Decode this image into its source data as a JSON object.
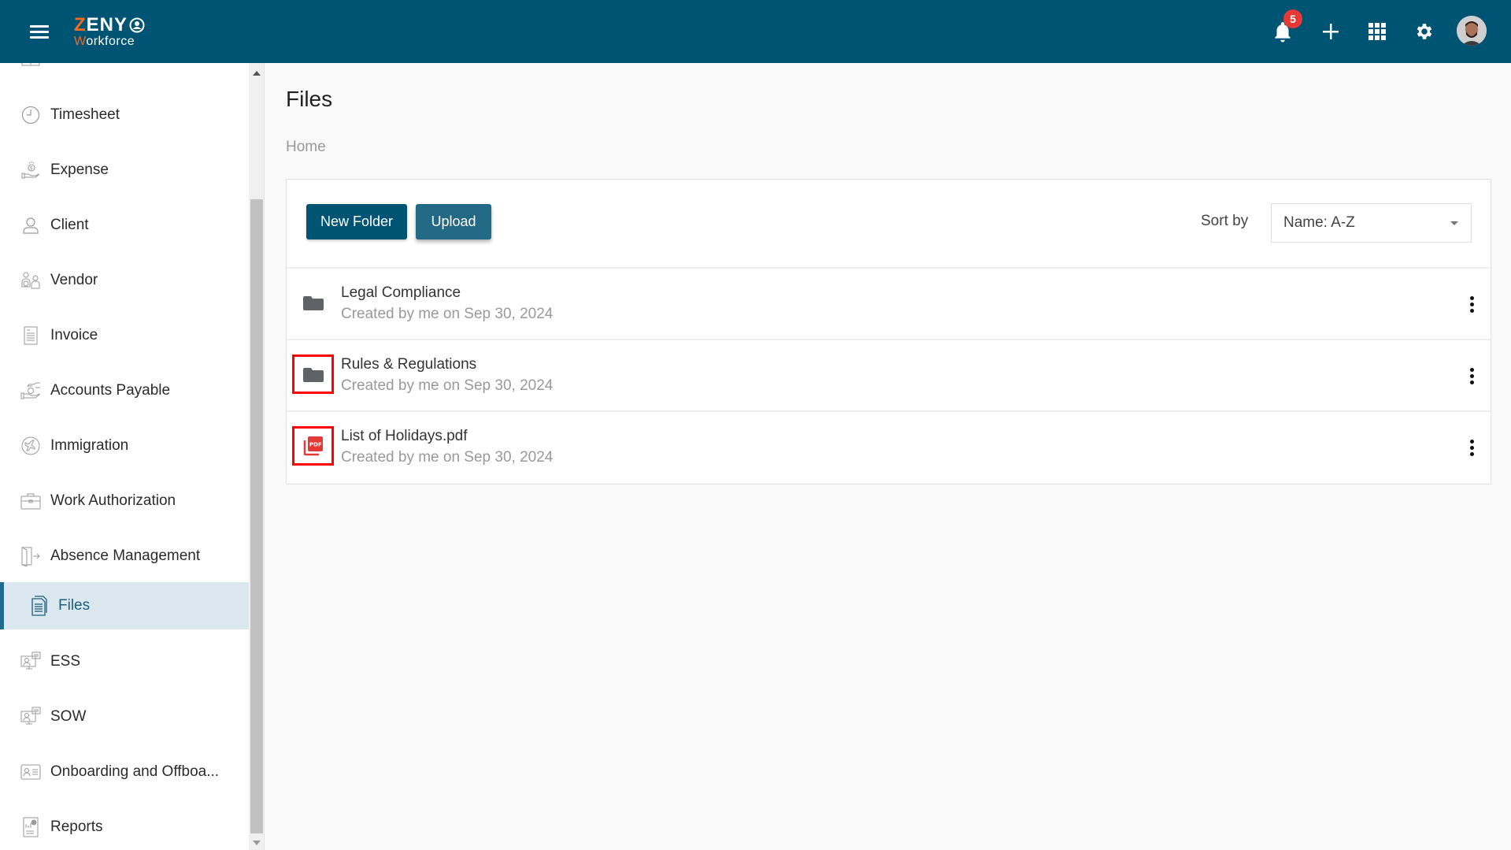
{
  "header": {
    "logo_top": "ZENY",
    "logo_top_first": "Z",
    "logo_top_rest": "ENY",
    "logo_bottom_first": "W",
    "logo_bottom_rest": "orkforce",
    "notification_count": "5",
    "icons": [
      "menu-icon",
      "bell-icon",
      "plus-icon",
      "apps-grid-icon",
      "gear-icon",
      "avatar"
    ]
  },
  "colors": {
    "header_bg": "#005473",
    "brand_orange": "#f26b21",
    "active_nav_bg": "#dce8ef",
    "active_nav_border": "#1f6c8c",
    "badge_red": "#e53935",
    "highlight_red": "#ff0000",
    "pdf_red": "#e53935"
  },
  "sidebar": {
    "items": [
      {
        "label": "Timesheet",
        "icon": "clock-icon"
      },
      {
        "label": "Expense",
        "icon": "hand-coin-icon"
      },
      {
        "label": "Client",
        "icon": "user-icon"
      },
      {
        "label": "Vendor",
        "icon": "vendor-icon"
      },
      {
        "label": "Invoice",
        "icon": "invoice-icon"
      },
      {
        "label": "Accounts Payable",
        "icon": "hand-money-icon"
      },
      {
        "label": "Immigration",
        "icon": "plane-icon"
      },
      {
        "label": "Work Authorization",
        "icon": "briefcase-icon"
      },
      {
        "label": "Absence Management",
        "icon": "door-exit-icon"
      },
      {
        "label": "Files",
        "icon": "file-icon",
        "active": true
      },
      {
        "label": "ESS",
        "icon": "ess-monitor-icon"
      },
      {
        "label": "SOW",
        "icon": "sow-monitor-icon"
      },
      {
        "label": "Onboarding and Offboa...",
        "icon": "id-card-icon"
      },
      {
        "label": "Reports",
        "icon": "report-icon"
      }
    ]
  },
  "main": {
    "title": "Files",
    "breadcrumb": "Home",
    "toolbar": {
      "new_folder_label": "New Folder",
      "upload_label": "Upload",
      "sort_label": "Sort by",
      "sort_value": "Name: A-Z"
    },
    "files": [
      {
        "name": "Legal Compliance",
        "meta": "Created by me on Sep 30, 2024",
        "type": "folder",
        "highlighted": false
      },
      {
        "name": "Rules & Regulations",
        "meta": "Created by me on Sep 30, 2024",
        "type": "folder",
        "highlighted": true
      },
      {
        "name": "List of Holidays.pdf",
        "meta": "Created by me on Sep 30, 2024",
        "type": "pdf",
        "highlighted": true
      }
    ]
  }
}
